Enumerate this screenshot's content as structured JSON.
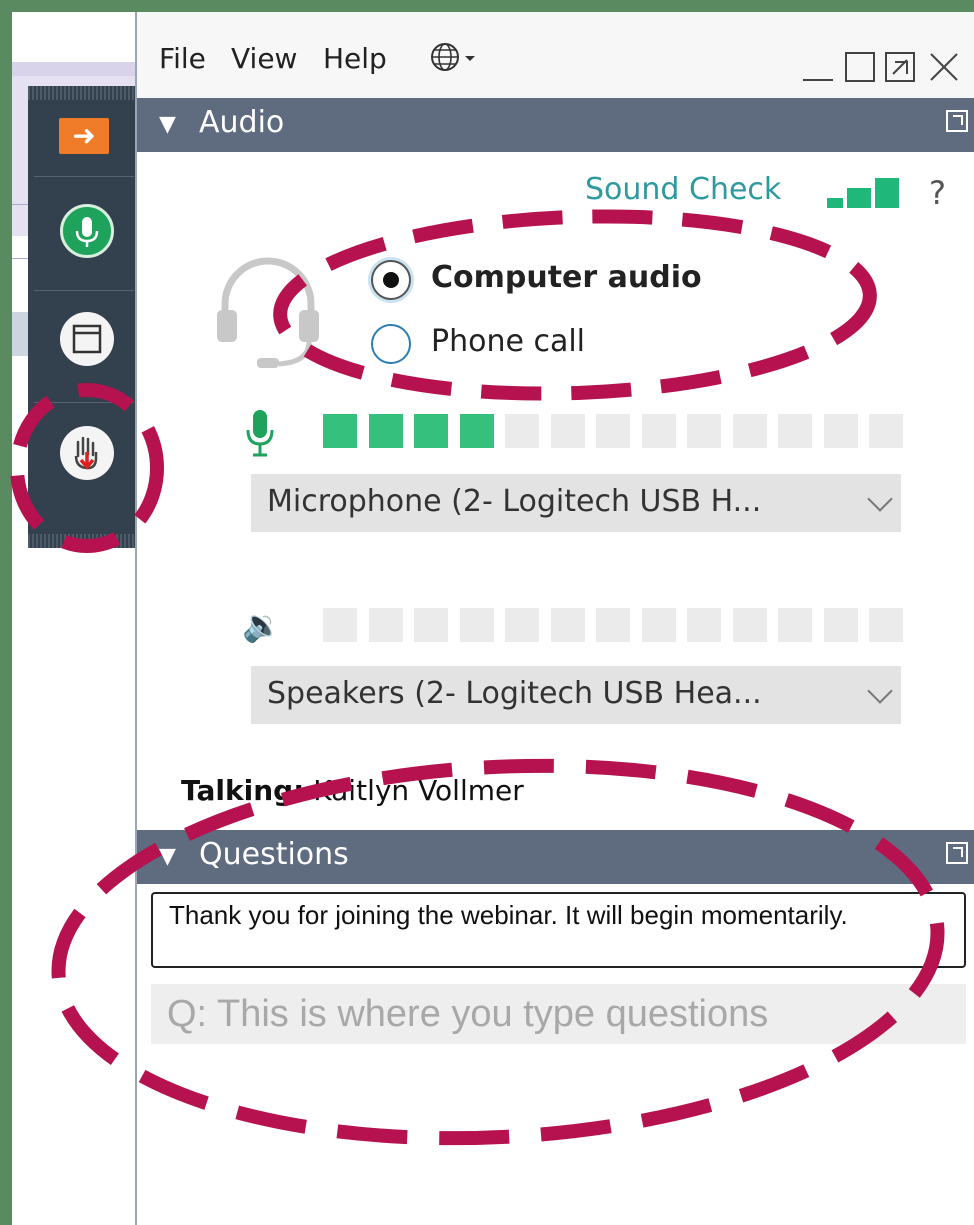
{
  "menu": {
    "file": "File",
    "view": "View",
    "help": "Help"
  },
  "audio": {
    "title": "Audio",
    "sound_check": "Sound Check",
    "help": "?",
    "options": [
      "Computer audio",
      "Phone call"
    ],
    "selected_option": "Computer audio",
    "microphone": {
      "device": "Microphone (2- Logitech USB H...",
      "level_on": 4,
      "level_total": 13
    },
    "speakers": {
      "device": "Speakers (2- Logitech USB Hea...",
      "level_on": 0,
      "level_total": 13
    },
    "talking_label": "Talking:",
    "talking_name": "Kaitlyn Vollmer"
  },
  "questions": {
    "title": "Questions",
    "message": "Thank you for joining the webinar. It will begin momentarily.",
    "input_placeholder": "Q: This is where you type questions"
  },
  "colors": {
    "annotation": "#b5124f",
    "section_header": "#5f6b7f",
    "level_on": "#36c07e",
    "accent_orange": "#f07c2a",
    "mic_green": "#1fa35c"
  }
}
